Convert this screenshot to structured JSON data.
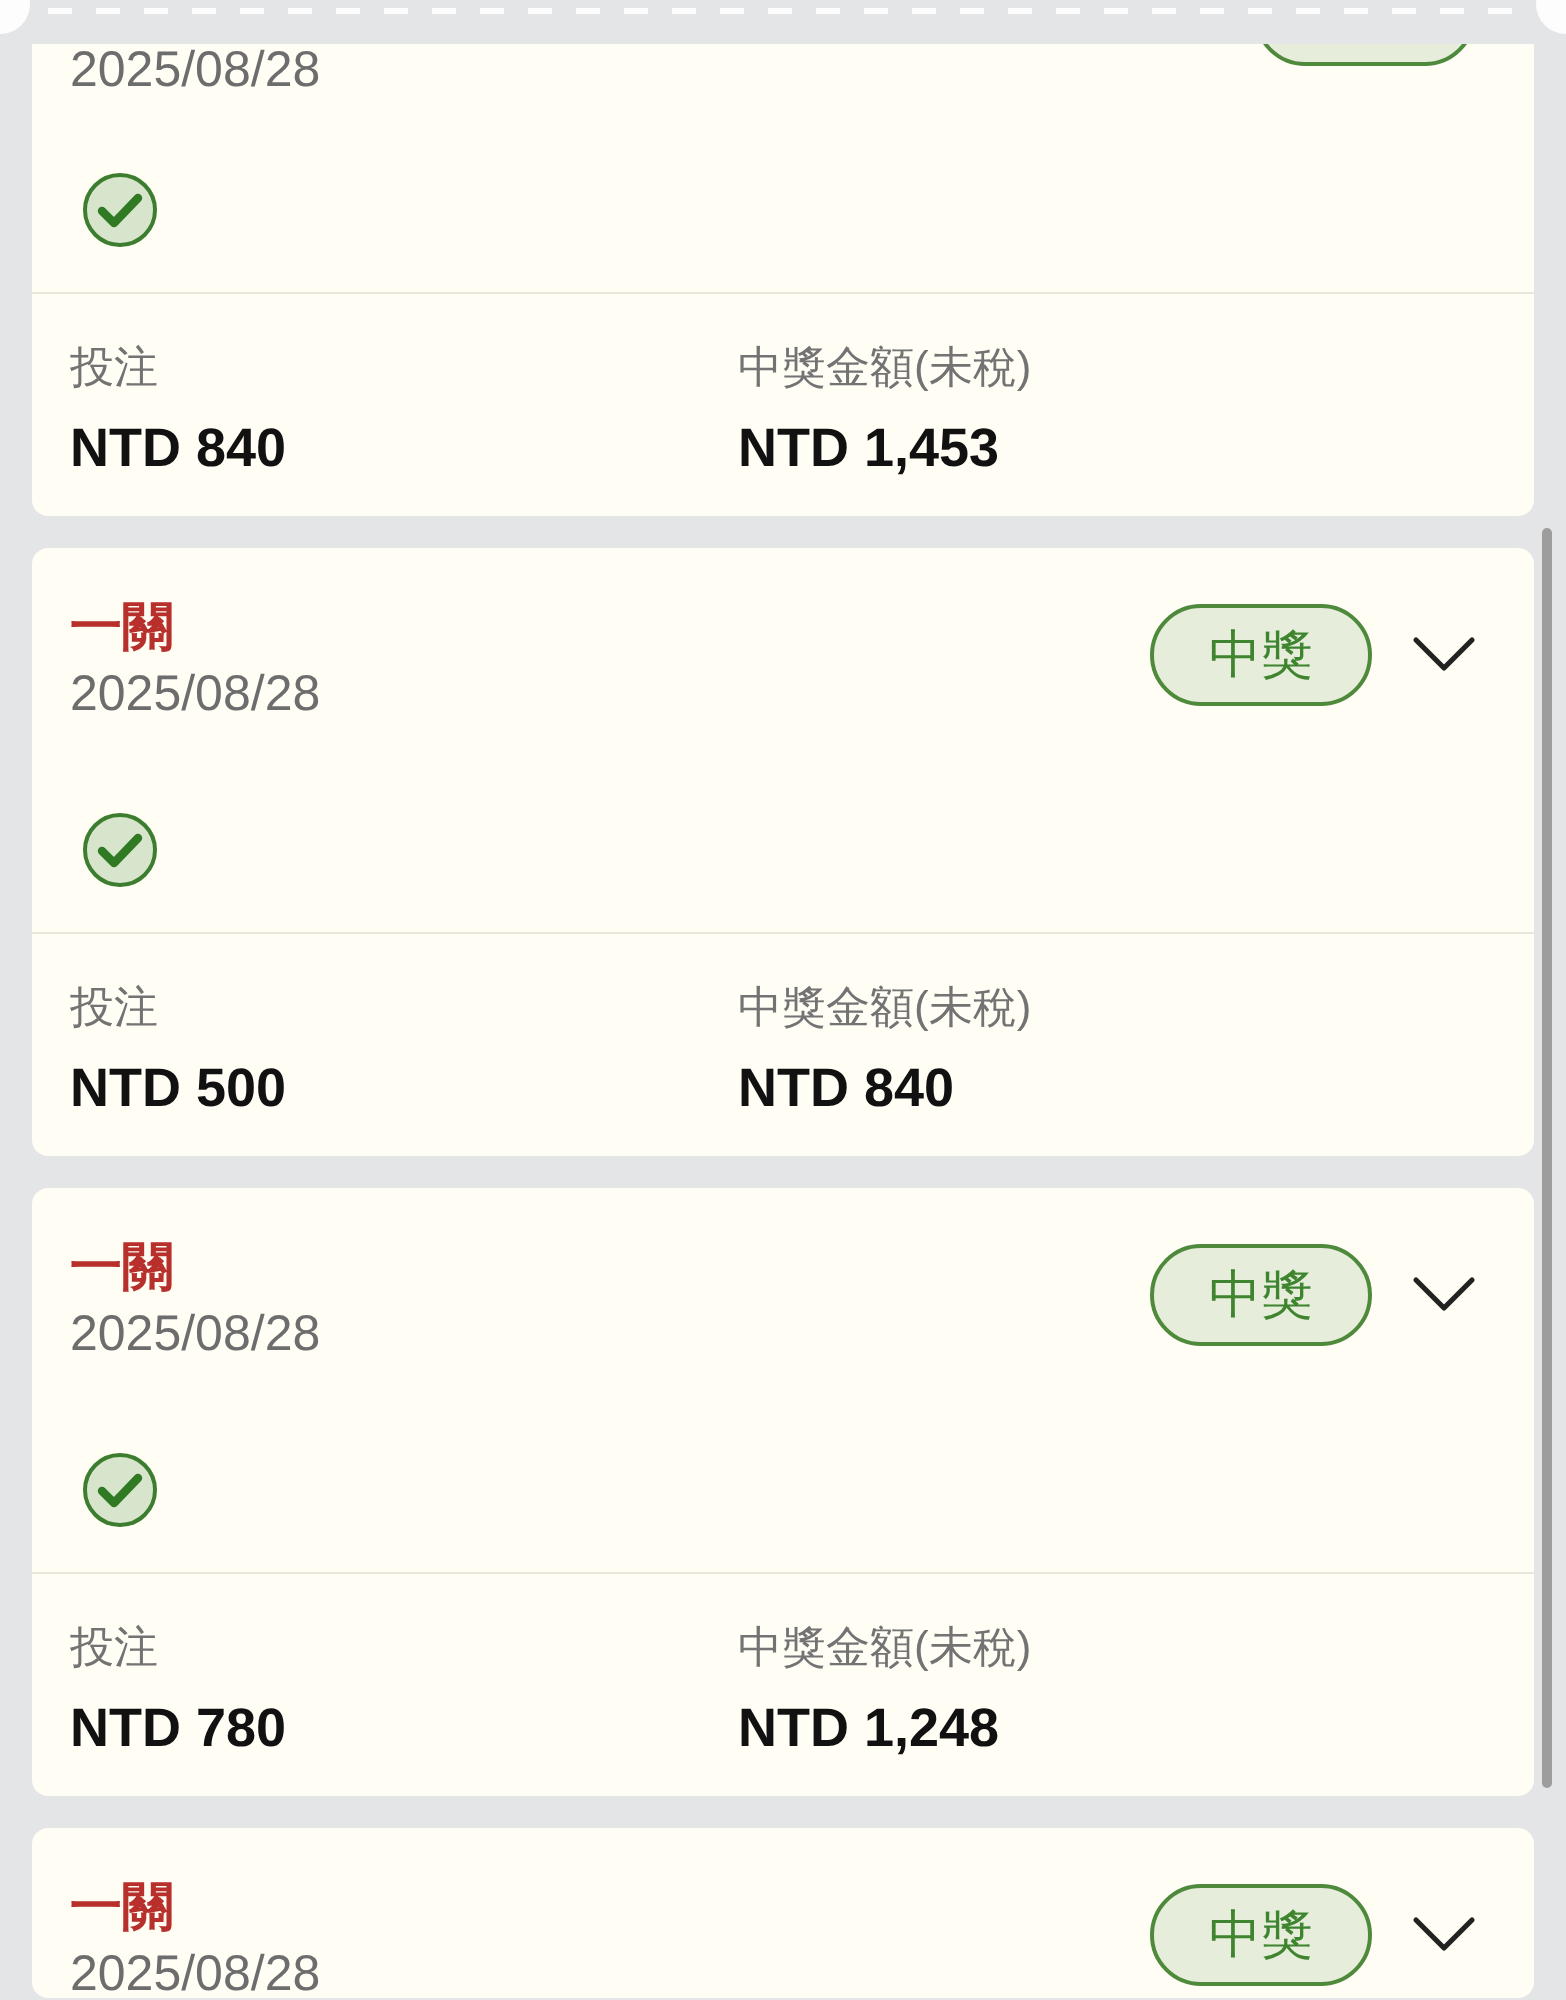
{
  "cards": [
    {
      "date": "2025/08/28",
      "badge": {
        "kind": "won"
      },
      "checked": true,
      "stake_label": "投注",
      "stake": "NTD 840",
      "prize_label": "中獎金額(未稅)",
      "prize": "NTD 1,453"
    },
    {
      "title": "一關",
      "date": "2025/08/28",
      "badge": {
        "label": "中獎",
        "kind": "won"
      },
      "expanded": false,
      "checked": true,
      "stake_label": "投注",
      "stake": "NTD 500",
      "prize_label": "中獎金額(未稅)",
      "prize": "NTD 840"
    },
    {
      "title": "一關",
      "date": "2025/08/28",
      "badge": {
        "label": "中獎",
        "kind": "won"
      },
      "expanded": false,
      "checked": true,
      "stake_label": "投注",
      "stake": "NTD 780",
      "prize_label": "中獎金額(未稅)",
      "prize": "NTD 1,248"
    },
    {
      "title": "一關",
      "date": "2025/08/28",
      "badge": {
        "label": "中獎",
        "kind": "won"
      },
      "expanded": false
    }
  ]
}
